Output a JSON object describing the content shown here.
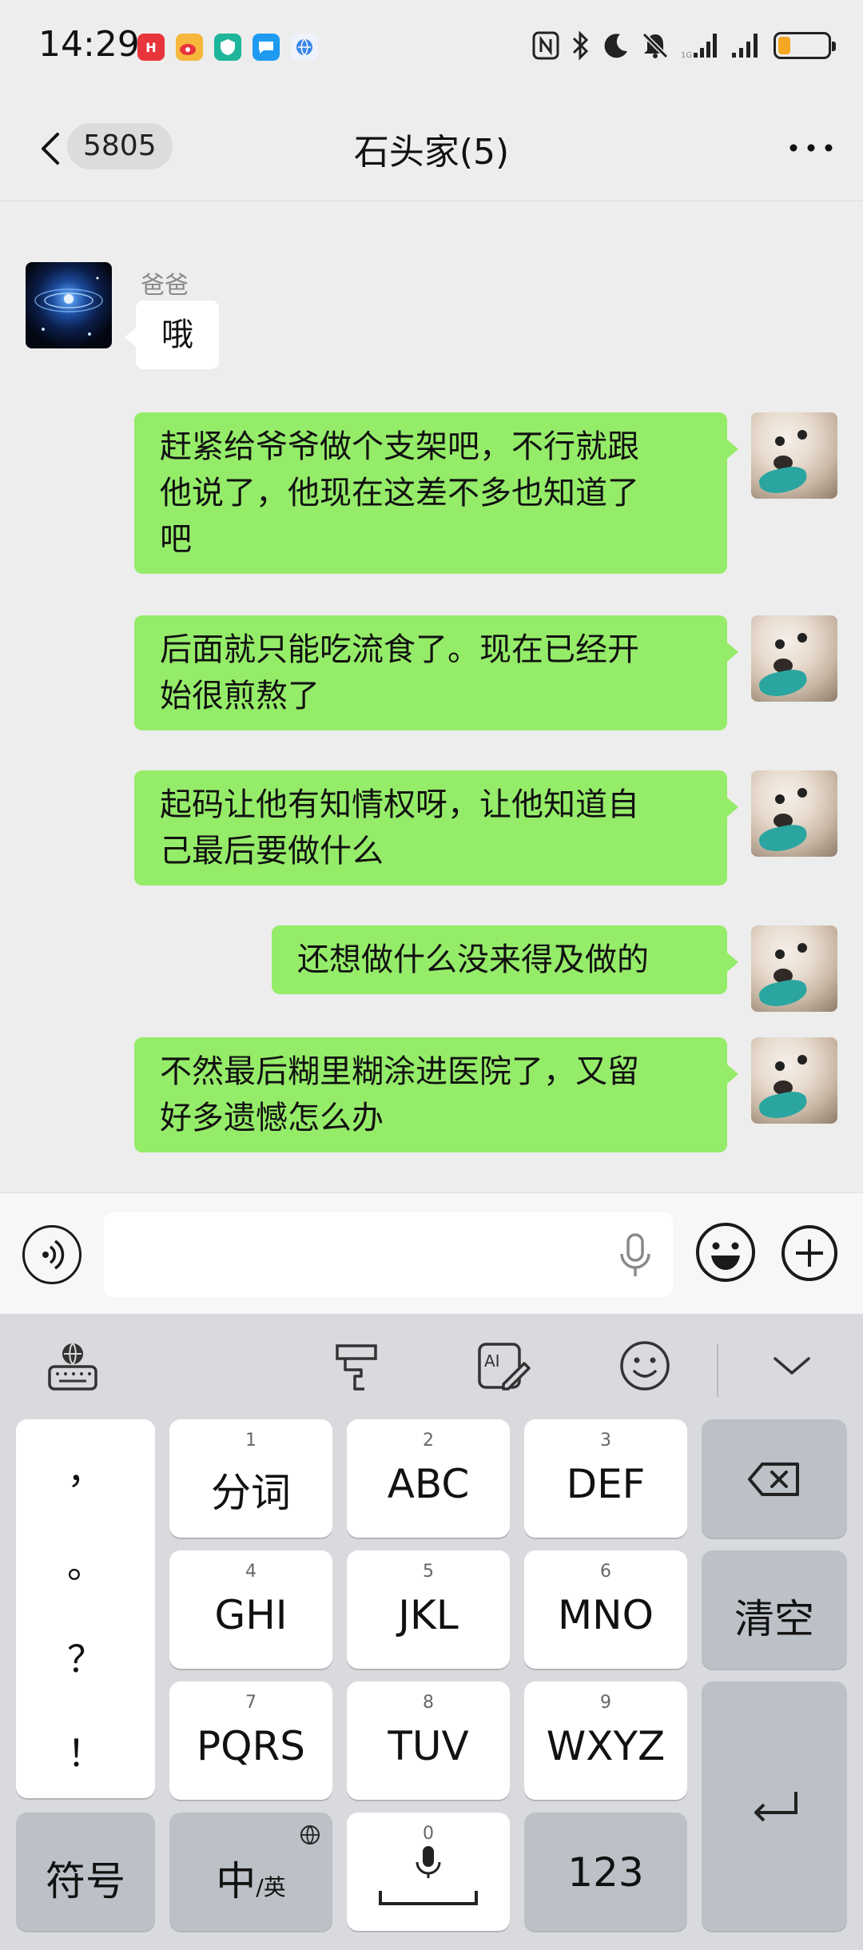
{
  "status_bar": {
    "time": "14:29",
    "apps": [
      {
        "icon": "huawei-app-icon",
        "color": "#e8353c"
      },
      {
        "icon": "weibo-icon",
        "color": "#f6b73c"
      },
      {
        "icon": "shield-app-icon",
        "color": "#1eb59b"
      },
      {
        "icon": "message-app-icon",
        "color": "#1e9bf0"
      },
      {
        "icon": "globe-app-icon",
        "color": "#3a86e8"
      }
    ],
    "battery_level": 0.25
  },
  "header": {
    "unread_count": "5805",
    "title": "石头家(5)"
  },
  "messages": [
    {
      "direction": "in",
      "sender": "爸爸",
      "avatar": "galaxy-avatar",
      "text": "哦"
    },
    {
      "direction": "out",
      "avatar": "dog-avatar",
      "lines": [
        "赶紧给爷爷做个支架吧，不行就跟",
        "他说了，他现在这差不多也知道了",
        "吧"
      ]
    },
    {
      "direction": "out",
      "avatar": "dog-avatar",
      "lines": [
        "后面就只能吃流食了。现在已经开",
        "始很煎熬了"
      ]
    },
    {
      "direction": "out",
      "avatar": "dog-avatar",
      "lines": [
        "起码让他有知情权呀，让他知道自",
        "己最后要做什么"
      ]
    },
    {
      "direction": "out",
      "avatar": "dog-avatar",
      "lines": [
        "还想做什么没来得及做的"
      ]
    },
    {
      "direction": "out",
      "avatar": "dog-avatar",
      "lines": [
        "不然最后糊里糊涂进医院了，又留",
        "好多遗憾怎么办"
      ]
    }
  ],
  "input": {
    "value": "",
    "placeholder": ""
  },
  "keyboard": {
    "toolbar": [
      "keyboard-globe-icon",
      "brush-icon",
      "ai-write-icon",
      "emoji-icon",
      "collapse-chevron-icon"
    ],
    "punctuation": [
      "，",
      "。",
      "？",
      "！"
    ],
    "keys": [
      {
        "num": "1",
        "label": "分词"
      },
      {
        "num": "2",
        "label": "ABC"
      },
      {
        "num": "3",
        "label": "DEF"
      },
      {
        "num": "4",
        "label": "GHI"
      },
      {
        "num": "5",
        "label": "JKL"
      },
      {
        "num": "6",
        "label": "MNO"
      },
      {
        "num": "7",
        "label": "PQRS"
      },
      {
        "num": "8",
        "label": "TUV"
      },
      {
        "num": "9",
        "label": "WXYZ"
      }
    ],
    "clear_label": "清空",
    "symbols_label": "符号",
    "lang_label_main": "中",
    "lang_label_sub": "/英",
    "space_num": "0",
    "num_label": "123"
  }
}
